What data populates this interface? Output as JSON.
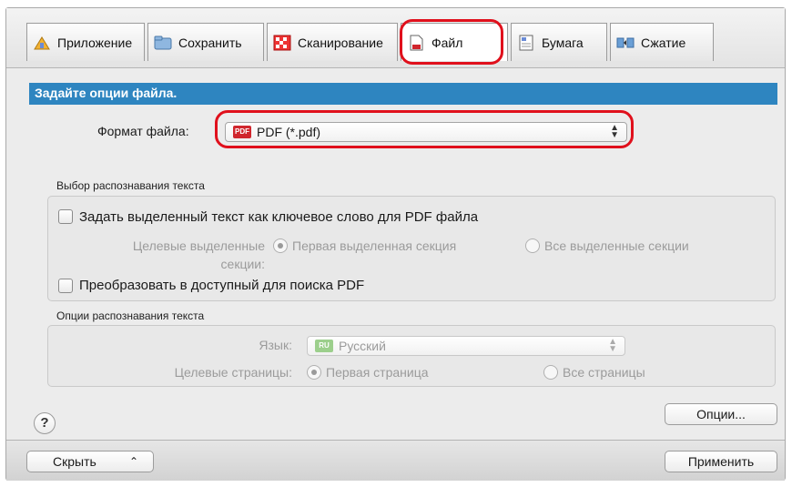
{
  "tabs": [
    {
      "label": "Приложение",
      "icon": "application-icon"
    },
    {
      "label": "Сохранить",
      "icon": "folder-icon"
    },
    {
      "label": "Сканирование",
      "icon": "scan-icon"
    },
    {
      "label": "Файл",
      "icon": "file-icon"
    },
    {
      "label": "Бумага",
      "icon": "paper-icon"
    },
    {
      "label": "Сжатие",
      "icon": "compression-icon"
    }
  ],
  "active_tab": "Файл",
  "banner": "Задайте опции файла.",
  "file_format": {
    "label": "Формат файла:",
    "badge": "PDF",
    "value": "PDF (*.pdf)"
  },
  "ocr_selection": {
    "title": "Выбор распознавания текста",
    "keyword_checkbox": "Задать выделенный текст как ключевое слово для PDF файла",
    "target_sections_label_1": "Целевые выделенные",
    "target_sections_label_2": "секции:",
    "option_first_section": "Первая выделенная секция",
    "option_all_sections": "Все выделенные секции",
    "searchable_checkbox": "Преобразовать в доступный для поиска PDF"
  },
  "ocr_options": {
    "title": "Опции распознавания текста",
    "language_label": "Язык:",
    "language_badge": "RU",
    "language_value": "Русский",
    "target_pages_label": "Целевые страницы:",
    "option_first_page": "Первая страница",
    "option_all_pages": "Все страницы"
  },
  "buttons": {
    "options": "Опции...",
    "hide": "Скрыть",
    "apply": "Применить",
    "help": "?"
  },
  "colors": {
    "accent": "#2e85c0",
    "highlight": "#e0101c"
  }
}
